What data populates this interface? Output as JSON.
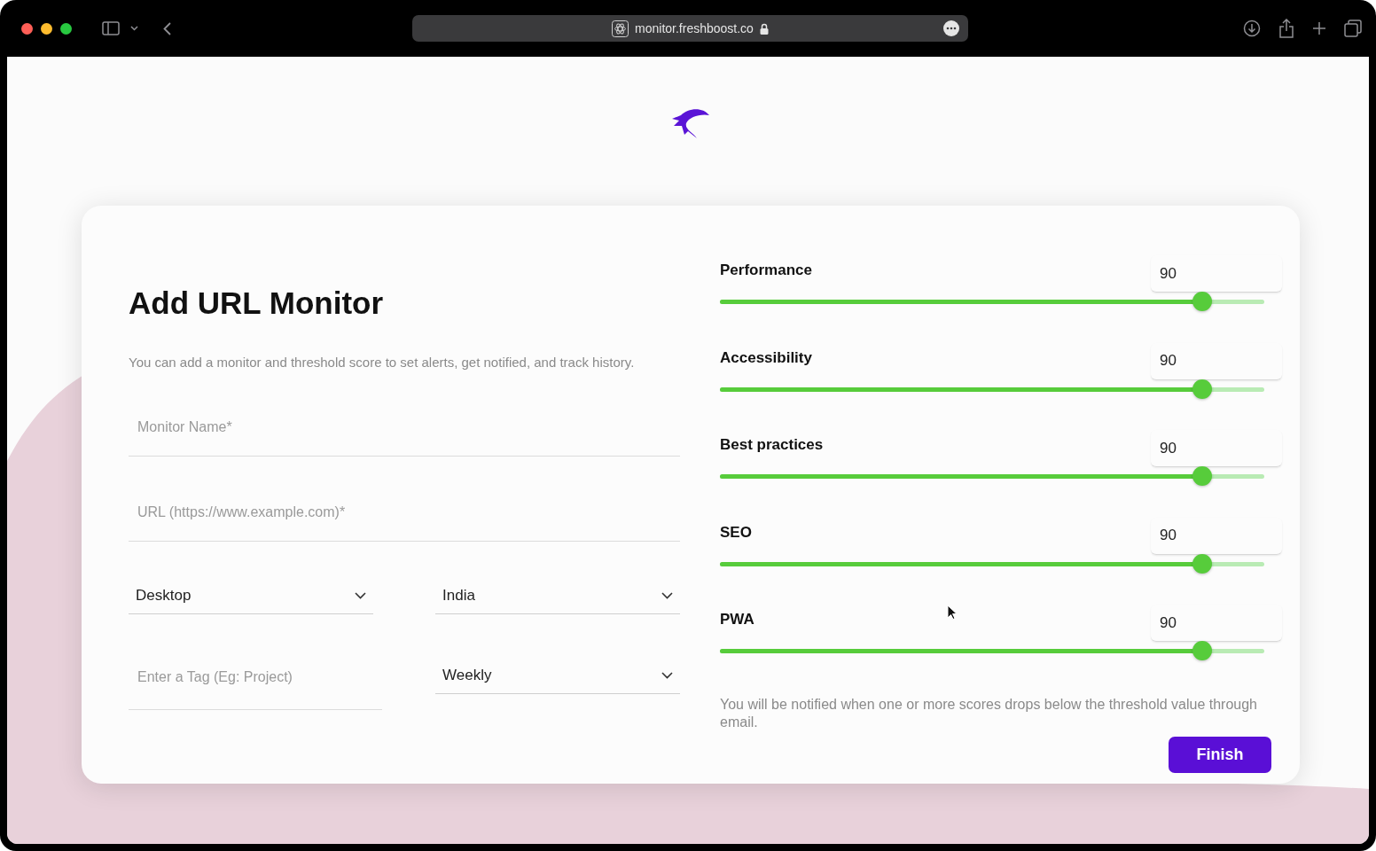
{
  "browser": {
    "url": "monitor.freshboost.co"
  },
  "form": {
    "title": "Add URL Monitor",
    "description": "You can add a monitor and threshold score to set alerts, get notified, and track history.",
    "monitor_name": {
      "placeholder": "Monitor Name*"
    },
    "url": {
      "placeholder": "URL (https://www.example.com)*"
    },
    "device": {
      "value": "Desktop"
    },
    "region": {
      "value": "India"
    },
    "tag": {
      "placeholder": "Enter a Tag (Eg: Project)"
    },
    "frequency": {
      "value": "Weekly"
    }
  },
  "thresholds": [
    {
      "label": "Performance",
      "value": "90",
      "level": 0.9
    },
    {
      "label": "Accessibility",
      "value": "90",
      "level": 0.9
    },
    {
      "label": "Best practices",
      "value": "90",
      "level": 0.9
    },
    {
      "label": "SEO",
      "value": "90",
      "level": 0.9
    },
    {
      "label": "PWA",
      "value": "90",
      "level": 0.9
    }
  ],
  "note": "You will be notified when one or more scores drops below the threshold value through email.",
  "finish_button": "Finish"
}
